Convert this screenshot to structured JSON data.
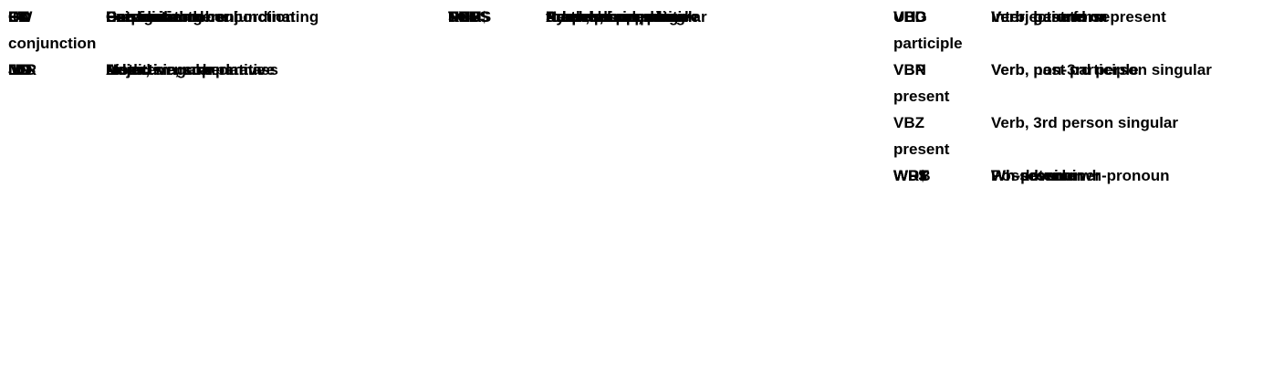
{
  "columns": [
    [
      {
        "tag": "CC",
        "description": "Coordinating conjunction"
      },
      {
        "tag": "CD",
        "description": "Cardinal number"
      },
      {
        "tag": "DT",
        "description": "Determiner"
      },
      {
        "tag": "EX",
        "description": "Existential there"
      },
      {
        "tag": "FW",
        "description": "Foreign word"
      },
      {
        "tag": "IN",
        "description": "Preposition or subordinating",
        "continuation": "conjunction"
      },
      {
        "tag": "JJ",
        "description": "Adjective"
      },
      {
        "tag": "JJR",
        "description": "Adjective, comparative"
      },
      {
        "tag": "JJS",
        "description": "Adjective, superlative"
      },
      {
        "tag": "LS",
        "description": "List item marker"
      },
      {
        "tag": "MD",
        "description": "Modal"
      },
      {
        "tag": "NN",
        "description": "Noun, singular or mass"
      }
    ],
    [
      {
        "tag": "NNS",
        "description": "Noun, plural"
      },
      {
        "tag": "NNP",
        "description": "Proper noun, singular"
      },
      {
        "tag": "NNPS",
        "description": "Proper noun, plural"
      },
      {
        "tag": "PDT",
        "description": "Predeterminer"
      },
      {
        "tag": "POS",
        "description": "Possessive ending"
      },
      {
        "tag": "PRP",
        "description": "Personal pronoun"
      },
      {
        "tag": "PRP$",
        "description": "Possessive pronoun"
      },
      {
        "tag": "RB",
        "description": "Adverb"
      },
      {
        "tag": "RBR",
        "description": "Adverb, comparative"
      },
      {
        "tag": "RBS",
        "description": "Adverb, superlative"
      },
      {
        "tag": "RP",
        "description": "Particle"
      },
      {
        "tag": "SYM",
        "description": "Symbol"
      },
      {
        "tag": "TO",
        "description": "to"
      }
    ],
    [
      {
        "tag": "UH",
        "description": "Interjection"
      },
      {
        "tag": "VB",
        "description": "Verb, base form"
      },
      {
        "tag": "VBD",
        "description": "Verb, past tense"
      },
      {
        "tag": "VBG",
        "description": "Verb, gerund or present",
        "continuation": "participle"
      },
      {
        "tag": "VBN",
        "description": "Verb, past participle"
      },
      {
        "tag": "VBP",
        "description": "Verb, non-3rd person singular",
        "continuation": "present"
      },
      {
        "tag": "VBZ",
        "description": "Verb, 3rd person singular",
        "continuation": "present"
      },
      {
        "tag": "WDT",
        "description": "Wh-determiner"
      },
      {
        "tag": "WP",
        "description": "Wh-pronoun"
      },
      {
        "tag": "WP$",
        "description": "Possessive wh-pronoun"
      },
      {
        "tag": "WRB",
        "description": "Wh-adverb"
      }
    ]
  ]
}
